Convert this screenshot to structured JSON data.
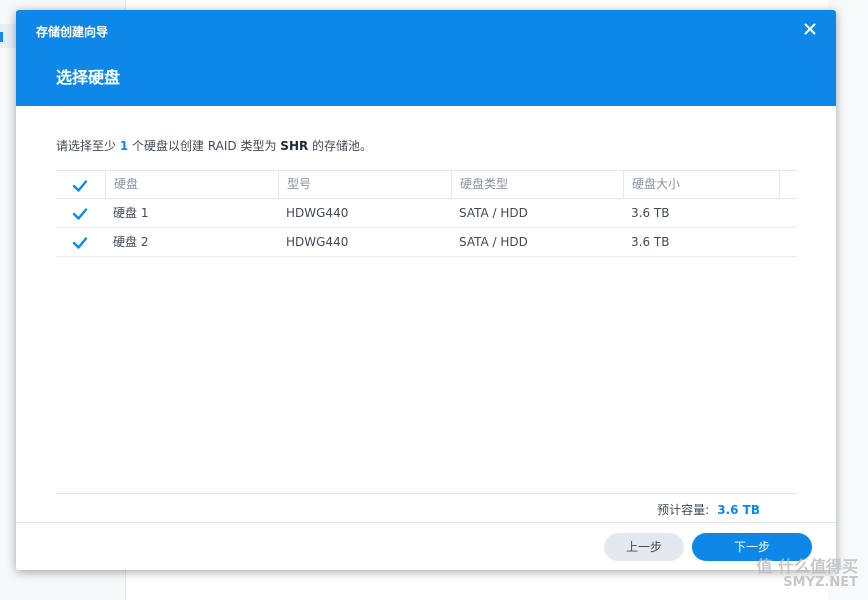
{
  "wizard": {
    "title": "存储创建向导",
    "step_title": "选择硬盘"
  },
  "instruction": {
    "prefix": "请选择至少 ",
    "count": "1",
    "middle": " 个硬盘以创建 RAID 类型为 ",
    "raid_type": "SHR",
    "suffix": " 的存储池。"
  },
  "table": {
    "headers": [
      "硬盘",
      "型号",
      "硬盘类型",
      "硬盘大小"
    ],
    "rows": [
      {
        "checked": true,
        "disk": "硬盘 1",
        "model": "HDWG440",
        "type": "SATA / HDD",
        "size": "3.6 TB"
      },
      {
        "checked": true,
        "disk": "硬盘 2",
        "model": "HDWG440",
        "type": "SATA / HDD",
        "size": "3.6 TB"
      }
    ]
  },
  "capacity": {
    "label": "预计容量:",
    "value": "3.6 TB"
  },
  "buttons": {
    "prev": "上一步",
    "next": "下一步"
  },
  "watermark": {
    "line1": "值 什么值得买",
    "line2": "SMYZ.NET"
  },
  "colors": {
    "accent": "#0d88e8",
    "header_bg": "#0d88e8",
    "prev_button_bg": "#e3e9ef"
  },
  "icons": {
    "close": "close-icon",
    "checkbox": "checkbox-checked-icon"
  }
}
